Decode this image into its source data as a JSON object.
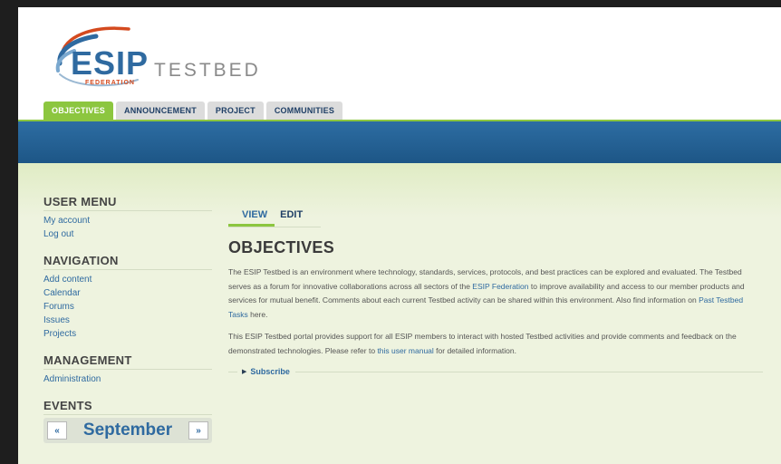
{
  "header": {
    "logo_main": "ESIP",
    "logo_sub": "FEDERATION",
    "logo_suffix": "TESTBED"
  },
  "primary_tabs": [
    {
      "label": "OBJECTIVES",
      "active": true
    },
    {
      "label": "ANNOUNCEMENT",
      "active": false
    },
    {
      "label": "PROJECT",
      "active": false
    },
    {
      "label": "COMMUNITIES",
      "active": false
    }
  ],
  "sidebar": {
    "user_menu": {
      "title": "USER MENU",
      "items": [
        "My account",
        "Log out"
      ]
    },
    "navigation": {
      "title": "NAVIGATION",
      "items": [
        "Add content",
        "Calendar",
        "Forums",
        "Issues",
        "Projects"
      ]
    },
    "management": {
      "title": "MANAGEMENT",
      "items": [
        "Administration"
      ]
    },
    "events": {
      "title": "EVENTS",
      "prev": "«",
      "month": "September",
      "next": "»"
    }
  },
  "main": {
    "local_tabs": [
      {
        "label": "VIEW",
        "active": true
      },
      {
        "label": "EDIT",
        "active": false
      }
    ],
    "title": "OBJECTIVES",
    "para1": {
      "t1": "The ESIP Testbed is an environment where technology, standards, services, protocols, and best practices can be explored and evaluated. The Testbed serves as a forum for innovative collaborations across all sectors of the ",
      "link1": "ESIP Federation",
      "t2": " to improve availability and access to our member products and services for mutual benefit. Comments about each current Testbed activity can be shared within this environment. Also find information on ",
      "link2": "Past Testbed Tasks",
      "t3": " here."
    },
    "para2": {
      "t1": "This ESIP Testbed portal provides support for all ESIP members to interact with hosted Testbed activities and provide comments and feedback on the demonstrated technologies. Please refer to ",
      "link1": "this user manual",
      "t2": " for detailed information."
    },
    "subscribe_label": "Subscribe"
  },
  "colors": {
    "accent_green": "#8cc63f",
    "brand_blue": "#2f6aa0",
    "bar_blue": "#1d5686"
  }
}
